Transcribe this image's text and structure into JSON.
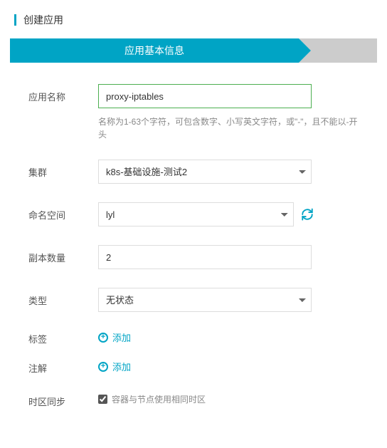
{
  "header": {
    "title": "创建应用"
  },
  "stepper": {
    "active": "应用基本信息"
  },
  "form": {
    "appName": {
      "label": "应用名称",
      "value": "proxy-iptables",
      "helper": "名称为1-63个字符，可包含数字、小写英文字符，或\"-\"，且不能以-开头"
    },
    "cluster": {
      "label": "集群",
      "value": "k8s-基础设施-测试2"
    },
    "namespace": {
      "label": "命名空间",
      "value": "lyl"
    },
    "replicas": {
      "label": "副本数量",
      "value": "2"
    },
    "type": {
      "label": "类型",
      "value": "无状态"
    },
    "labels": {
      "label": "标签",
      "addText": "添加"
    },
    "annotations": {
      "label": "注解",
      "addText": "添加"
    },
    "tzSync": {
      "label": "时区同步",
      "checkboxLabel": "容器与节点使用相同时区",
      "checked": true
    }
  }
}
